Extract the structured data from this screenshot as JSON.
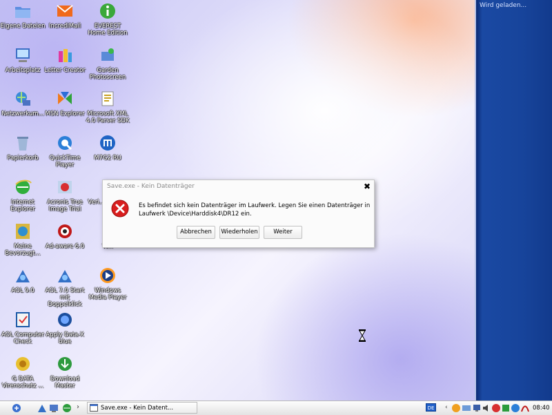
{
  "desktop_icons": [
    {
      "label": "Eigene Dateien",
      "icon": "folder-icon"
    },
    {
      "label": "IncrediMail",
      "icon": "mail-icon"
    },
    {
      "label": "EVEREST Home Edition",
      "icon": "info-icon"
    },
    {
      "label": "Arbeitsplatz",
      "icon": "computer-icon"
    },
    {
      "label": "Letter Creator",
      "icon": "letter-creator-icon"
    },
    {
      "label": "Garden Photoscreen",
      "icon": "garden-icon"
    },
    {
      "label": "Netzwerkum...",
      "icon": "network-icon"
    },
    {
      "label": "MSN Explorer",
      "icon": "msn-icon"
    },
    {
      "label": "Microsoft XML 4.0 Parser SDK",
      "icon": "xml-icon"
    },
    {
      "label": "Papierkorb",
      "icon": "recycle-bin-icon"
    },
    {
      "label": "QuickTime Player",
      "icon": "quicktime-icon"
    },
    {
      "label": "M7G2 RU",
      "icon": "m7g2-icon"
    },
    {
      "label": "Internet Explorer",
      "icon": "internet-explorer-icon"
    },
    {
      "label": "Acronis True Image Trial",
      "icon": "acronis-icon"
    },
    {
      "label": "Veri... mit S...",
      "icon": "veri-icon"
    },
    {
      "label": "Meine Bevorzugt...",
      "icon": "favorites-icon"
    },
    {
      "label": "Ad-aware 6.0",
      "icon": "adaware-icon"
    },
    {
      "label": "W...",
      "icon": "w-icon"
    },
    {
      "label": "AOL 9.0",
      "icon": "aol-icon"
    },
    {
      "label": "AOL 7.0 Start mit Doppelklick",
      "icon": "aol-start-icon"
    },
    {
      "label": "Windows Media Player",
      "icon": "media-player-icon"
    },
    {
      "label": "AOL Computer Check",
      "icon": "aol-check-icon"
    },
    {
      "label": "Apply Data-X blue",
      "icon": "apply-data-icon"
    },
    {
      "label": "G DATA Virenschutz ...",
      "icon": "gdata-icon"
    },
    {
      "label": "Download Master",
      "icon": "download-master-icon"
    }
  ],
  "sidebar": {
    "status": "Wird geladen..."
  },
  "dialog": {
    "title": "Save.exe - Kein Datenträger",
    "close_symbol": "✖",
    "message": "Es befindet sich kein Datenträger im Laufwerk. Legen Sie einen Datenträger in Laufwerk \\Device\\Harddisk4\\DR12 ein.",
    "buttons": {
      "cancel": "Abbrechen",
      "retry": "Wiederholen",
      "continue": "Weiter"
    }
  },
  "taskbar": {
    "quick_launch": [
      "start-icon",
      "aol-icon",
      "desktop-icon",
      "internet-icon"
    ],
    "chevron": "›",
    "task_label": "Save.exe - Kein Datent...",
    "language": "DE",
    "tray_chevron": "‹",
    "tray_icons": [
      "tray-security-icon",
      "tray-network-icon",
      "tray-monitor-icon",
      "tray-volume-icon",
      "tray-app-icon",
      "tray-shield-icon",
      "tray-update-icon",
      "tray-acrobat-icon"
    ],
    "clock": "08:40"
  },
  "colors": {
    "sidebar": "#17449b",
    "error_red": "#d81e1e",
    "language_badge": "#1f5fc8"
  }
}
